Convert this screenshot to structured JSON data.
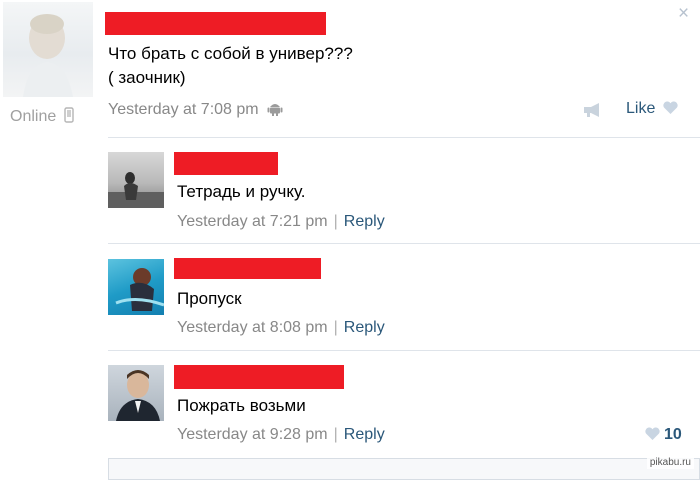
{
  "post": {
    "text_line1": "Что брать с собой в универ???",
    "text_line2": "( заочник)",
    "timestamp": "Yesterday at 7:08 pm",
    "like_label": "Like",
    "close_glyph": "×",
    "author_status": "Online",
    "platform_icon": "android-icon"
  },
  "comments": [
    {
      "text": "Тетрадь и ручку.",
      "timestamp": "Yesterday at 7:21 pm",
      "separator": "|",
      "reply_label": "Reply"
    },
    {
      "text": "Пропуск",
      "timestamp": "Yesterday at 8:08 pm",
      "separator": "|",
      "reply_label": "Reply"
    },
    {
      "text": "Пожрать возьми",
      "timestamp": "Yesterday at 9:28 pm",
      "separator": "|",
      "reply_label": "Reply",
      "like_count": "10"
    }
  ],
  "watermark": "pikabu.ru",
  "colors": {
    "redaction": "#ee1c25",
    "link": "#2b587a",
    "meta": "#888888",
    "divider": "#dfe4ea"
  }
}
